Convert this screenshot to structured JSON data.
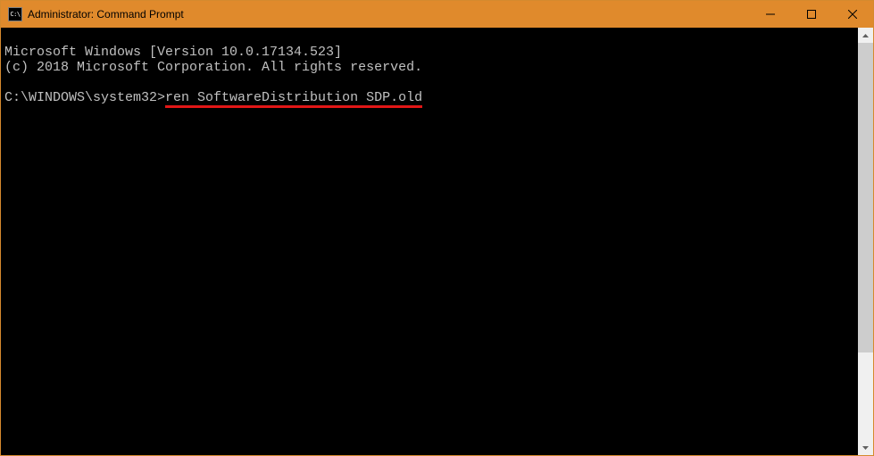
{
  "titlebar": {
    "icon_label": "C:\\",
    "title": "Administrator: Command Prompt"
  },
  "terminal": {
    "line1": "Microsoft Windows [Version 10.0.17134.523]",
    "line2": "(c) 2018 Microsoft Corporation. All rights reserved.",
    "prompt": "C:\\WINDOWS\\system32>",
    "command": "ren SoftwareDistribution SDP.old"
  }
}
